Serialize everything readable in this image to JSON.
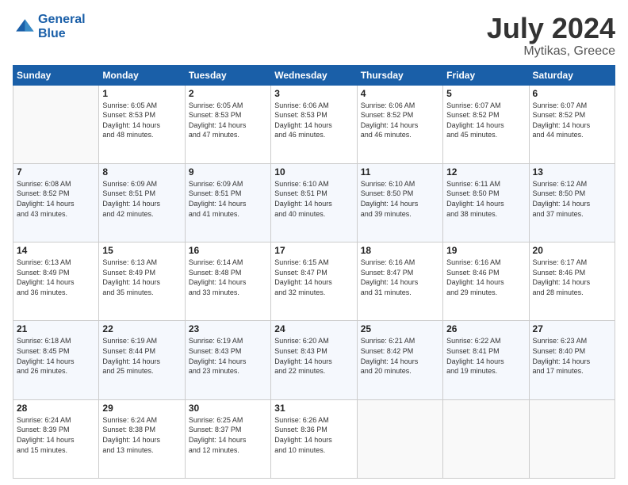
{
  "logo": {
    "line1": "General",
    "line2": "Blue"
  },
  "title": "July 2024",
  "subtitle": "Mytikas, Greece",
  "days_of_week": [
    "Sunday",
    "Monday",
    "Tuesday",
    "Wednesday",
    "Thursday",
    "Friday",
    "Saturday"
  ],
  "weeks": [
    [
      {
        "day": "",
        "info": ""
      },
      {
        "day": "1",
        "info": "Sunrise: 6:05 AM\nSunset: 8:53 PM\nDaylight: 14 hours\nand 48 minutes."
      },
      {
        "day": "2",
        "info": "Sunrise: 6:05 AM\nSunset: 8:53 PM\nDaylight: 14 hours\nand 47 minutes."
      },
      {
        "day": "3",
        "info": "Sunrise: 6:06 AM\nSunset: 8:53 PM\nDaylight: 14 hours\nand 46 minutes."
      },
      {
        "day": "4",
        "info": "Sunrise: 6:06 AM\nSunset: 8:52 PM\nDaylight: 14 hours\nand 46 minutes."
      },
      {
        "day": "5",
        "info": "Sunrise: 6:07 AM\nSunset: 8:52 PM\nDaylight: 14 hours\nand 45 minutes."
      },
      {
        "day": "6",
        "info": "Sunrise: 6:07 AM\nSunset: 8:52 PM\nDaylight: 14 hours\nand 44 minutes."
      }
    ],
    [
      {
        "day": "7",
        "info": "Sunrise: 6:08 AM\nSunset: 8:52 PM\nDaylight: 14 hours\nand 43 minutes."
      },
      {
        "day": "8",
        "info": "Sunrise: 6:09 AM\nSunset: 8:51 PM\nDaylight: 14 hours\nand 42 minutes."
      },
      {
        "day": "9",
        "info": "Sunrise: 6:09 AM\nSunset: 8:51 PM\nDaylight: 14 hours\nand 41 minutes."
      },
      {
        "day": "10",
        "info": "Sunrise: 6:10 AM\nSunset: 8:51 PM\nDaylight: 14 hours\nand 40 minutes."
      },
      {
        "day": "11",
        "info": "Sunrise: 6:10 AM\nSunset: 8:50 PM\nDaylight: 14 hours\nand 39 minutes."
      },
      {
        "day": "12",
        "info": "Sunrise: 6:11 AM\nSunset: 8:50 PM\nDaylight: 14 hours\nand 38 minutes."
      },
      {
        "day": "13",
        "info": "Sunrise: 6:12 AM\nSunset: 8:50 PM\nDaylight: 14 hours\nand 37 minutes."
      }
    ],
    [
      {
        "day": "14",
        "info": "Sunrise: 6:13 AM\nSunset: 8:49 PM\nDaylight: 14 hours\nand 36 minutes."
      },
      {
        "day": "15",
        "info": "Sunrise: 6:13 AM\nSunset: 8:49 PM\nDaylight: 14 hours\nand 35 minutes."
      },
      {
        "day": "16",
        "info": "Sunrise: 6:14 AM\nSunset: 8:48 PM\nDaylight: 14 hours\nand 33 minutes."
      },
      {
        "day": "17",
        "info": "Sunrise: 6:15 AM\nSunset: 8:47 PM\nDaylight: 14 hours\nand 32 minutes."
      },
      {
        "day": "18",
        "info": "Sunrise: 6:16 AM\nSunset: 8:47 PM\nDaylight: 14 hours\nand 31 minutes."
      },
      {
        "day": "19",
        "info": "Sunrise: 6:16 AM\nSunset: 8:46 PM\nDaylight: 14 hours\nand 29 minutes."
      },
      {
        "day": "20",
        "info": "Sunrise: 6:17 AM\nSunset: 8:46 PM\nDaylight: 14 hours\nand 28 minutes."
      }
    ],
    [
      {
        "day": "21",
        "info": "Sunrise: 6:18 AM\nSunset: 8:45 PM\nDaylight: 14 hours\nand 26 minutes."
      },
      {
        "day": "22",
        "info": "Sunrise: 6:19 AM\nSunset: 8:44 PM\nDaylight: 14 hours\nand 25 minutes."
      },
      {
        "day": "23",
        "info": "Sunrise: 6:19 AM\nSunset: 8:43 PM\nDaylight: 14 hours\nand 23 minutes."
      },
      {
        "day": "24",
        "info": "Sunrise: 6:20 AM\nSunset: 8:43 PM\nDaylight: 14 hours\nand 22 minutes."
      },
      {
        "day": "25",
        "info": "Sunrise: 6:21 AM\nSunset: 8:42 PM\nDaylight: 14 hours\nand 20 minutes."
      },
      {
        "day": "26",
        "info": "Sunrise: 6:22 AM\nSunset: 8:41 PM\nDaylight: 14 hours\nand 19 minutes."
      },
      {
        "day": "27",
        "info": "Sunrise: 6:23 AM\nSunset: 8:40 PM\nDaylight: 14 hours\nand 17 minutes."
      }
    ],
    [
      {
        "day": "28",
        "info": "Sunrise: 6:24 AM\nSunset: 8:39 PM\nDaylight: 14 hours\nand 15 minutes."
      },
      {
        "day": "29",
        "info": "Sunrise: 6:24 AM\nSunset: 8:38 PM\nDaylight: 14 hours\nand 13 minutes."
      },
      {
        "day": "30",
        "info": "Sunrise: 6:25 AM\nSunset: 8:37 PM\nDaylight: 14 hours\nand 12 minutes."
      },
      {
        "day": "31",
        "info": "Sunrise: 6:26 AM\nSunset: 8:36 PM\nDaylight: 14 hours\nand 10 minutes."
      },
      {
        "day": "",
        "info": ""
      },
      {
        "day": "",
        "info": ""
      },
      {
        "day": "",
        "info": ""
      }
    ]
  ]
}
